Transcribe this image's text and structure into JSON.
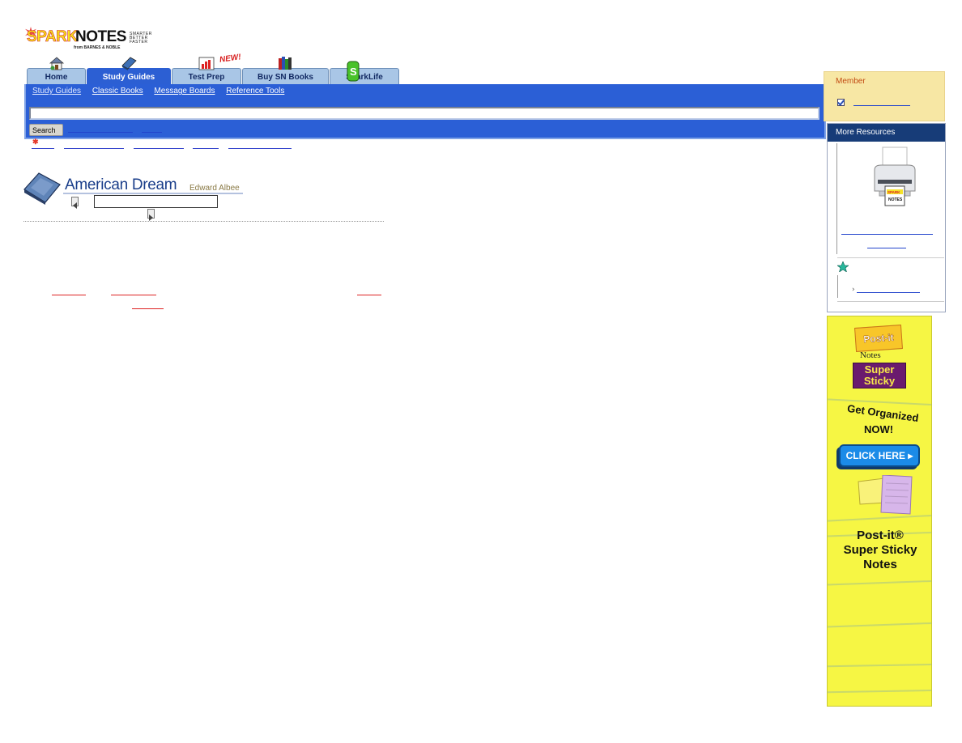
{
  "logo": {
    "spark": "SPARK",
    "notes": "NOTES",
    "tagline": [
      "SMARTER",
      "BETTER",
      "FASTER"
    ],
    "byline": "from BARNES & NOBLE"
  },
  "tabs": [
    {
      "label": "Home",
      "active": false
    },
    {
      "label": "Study Guides",
      "active": true
    },
    {
      "label": "Test Prep",
      "active": false
    },
    {
      "label": "Buy SN Books",
      "active": false
    },
    {
      "label": "SparkLife",
      "active": false
    }
  ],
  "new_badge": "NEW!",
  "subnav": [
    "Study Guides",
    "Classic Books",
    "Message Boards",
    "Reference Tools"
  ],
  "search": {
    "button_label": "Search",
    "value": ""
  },
  "guide": {
    "title": "American Dream",
    "author": "Edward Albee"
  },
  "sidebar": {
    "member_title": "Member",
    "resources_title": "More Resources"
  },
  "ad": {
    "brand": "Post-it",
    "notes": "Notes",
    "super_sticky": "Super Sticky",
    "headline": "Get Organized",
    "now": "NOW!",
    "cta": "CLICK HERE",
    "product_line1": "Post-it®",
    "product_line2": "Super Sticky",
    "product_line3": "Notes"
  },
  "colors": {
    "nav_blue": "#2b5fd6",
    "member_bg": "#f7e7a4",
    "resources_header": "#173c78",
    "ad_bg": "#f6f644"
  }
}
